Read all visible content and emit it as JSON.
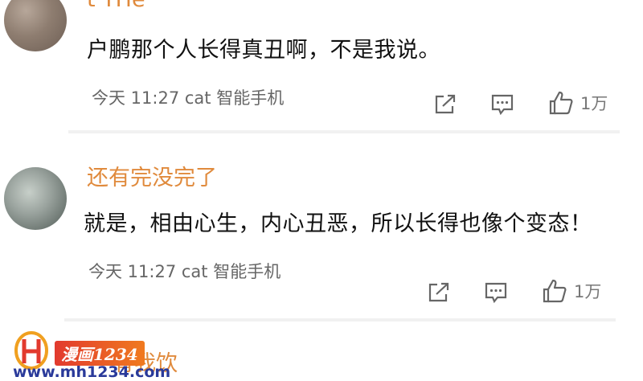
{
  "comments": [
    {
      "username": "t THe",
      "text": "户鹏那个人长得真丑啊，不是我说。",
      "meta": "今天 11:27 cat 智能手机",
      "likes": "1万"
    },
    {
      "username": "还有完没完了",
      "text": "就是，相由心生，内心丑恶，所以长得也像个变态！",
      "meta": "今天 11:27 cat 智能手机",
      "likes": "1万"
    },
    {
      "username": "有我饮"
    }
  ],
  "watermark": {
    "badge": "漫画1234",
    "url": "www.mh1234.com"
  },
  "colors": {
    "username": "#e08a3c",
    "text": "#111111",
    "meta": "#666666",
    "divider": "#f1f1f1"
  },
  "icons": [
    "share-icon",
    "comment-icon",
    "thumbs-up-icon"
  ]
}
